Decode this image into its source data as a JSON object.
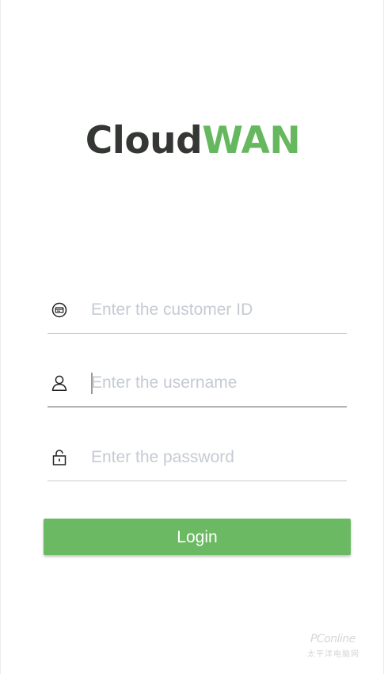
{
  "logo": {
    "part1": "Cloud",
    "part2": "WAN",
    "colors": {
      "dark": "#343733",
      "accent": "#66b85f"
    }
  },
  "form": {
    "customer_id": {
      "placeholder": "Enter the customer ID",
      "value": "",
      "icon": "id-card-icon"
    },
    "username": {
      "placeholder": "Enter the username",
      "value": "",
      "icon": "user-icon",
      "focused": true
    },
    "password": {
      "placeholder": "Enter the password",
      "value": "",
      "icon": "lock-icon"
    }
  },
  "login_button": {
    "label": "Login",
    "color": "#6cb963"
  },
  "watermark": {
    "text": "PConline",
    "sub": "太平洋电脑网"
  }
}
